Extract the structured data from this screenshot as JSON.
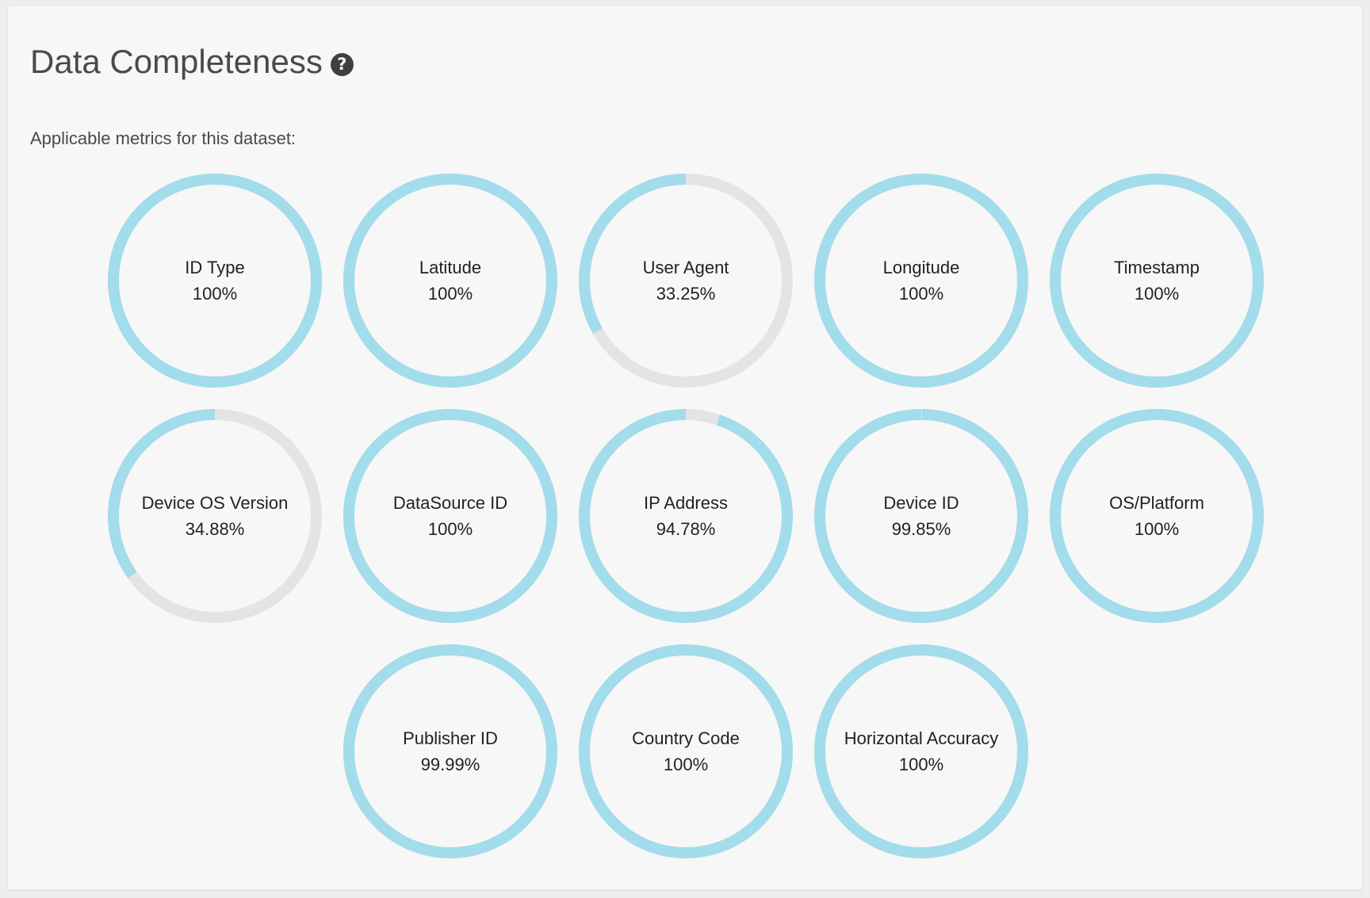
{
  "header": {
    "title": "Data Completeness",
    "help_icon": "question-circle-icon",
    "subtitle": "Applicable metrics for this dataset:"
  },
  "colors": {
    "fill": "#a3dcea",
    "track": "#e4e4e7"
  },
  "metrics": [
    {
      "label": "ID Type",
      "value": "100%",
      "fraction": 1.0
    },
    {
      "label": "Latitude",
      "value": "100%",
      "fraction": 1.0
    },
    {
      "label": "User Agent",
      "value": "33.25%",
      "fraction": 0.3325
    },
    {
      "label": "Longitude",
      "value": "100%",
      "fraction": 1.0
    },
    {
      "label": "Timestamp",
      "value": "100%",
      "fraction": 1.0
    },
    {
      "label": "Device OS Version",
      "value": "34.88%",
      "fraction": 0.3488
    },
    {
      "label": "DataSource ID",
      "value": "100%",
      "fraction": 1.0
    },
    {
      "label": "IP Address",
      "value": "94.78%",
      "fraction": 0.9478
    },
    {
      "label": "Device ID",
      "value": "99.85%",
      "fraction": 0.9985
    },
    {
      "label": "OS/Platform",
      "value": "100%",
      "fraction": 1.0
    },
    {
      "label": "Publisher ID",
      "value": "99.99%",
      "fraction": 0.9999
    },
    {
      "label": "Country Code",
      "value": "100%",
      "fraction": 1.0
    },
    {
      "label": "Horizontal Accuracy",
      "value": "100%",
      "fraction": 1.0
    }
  ]
}
